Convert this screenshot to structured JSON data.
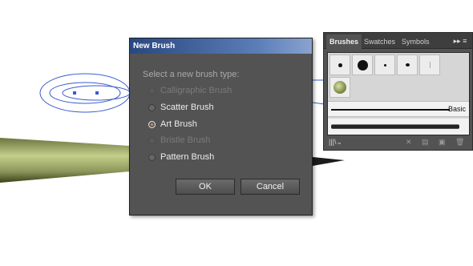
{
  "dialog": {
    "title": "New Brush",
    "prompt": "Select a new brush type:",
    "options": [
      {
        "label": "Calligraphic Brush",
        "enabled": false,
        "selected": false
      },
      {
        "label": "Scatter Brush",
        "enabled": true,
        "selected": false
      },
      {
        "label": "Art Brush",
        "enabled": true,
        "selected": true
      },
      {
        "label": "Bristle Brush",
        "enabled": false,
        "selected": false
      },
      {
        "label": "Pattern Brush",
        "enabled": true,
        "selected": false
      }
    ],
    "ok_label": "OK",
    "cancel_label": "Cancel"
  },
  "brushes_panel": {
    "tabs": [
      "Brushes",
      "Swatches",
      "Symbols"
    ],
    "active_tab": "Brushes",
    "menu_icon": "panel-menu-icon",
    "basic_label": "Basic",
    "footer_icons": [
      "brush-libraries-icon",
      "remove-stroke-icon",
      "options-icon",
      "new-brush-icon",
      "delete-brush-icon"
    ]
  },
  "colors": {
    "dialog_bg": "#535353",
    "title_bar": "#29477f",
    "selection_path": "#3a5ccc",
    "art_brush_shape": "#9aa663",
    "radio_accent": "#f08a3a"
  }
}
